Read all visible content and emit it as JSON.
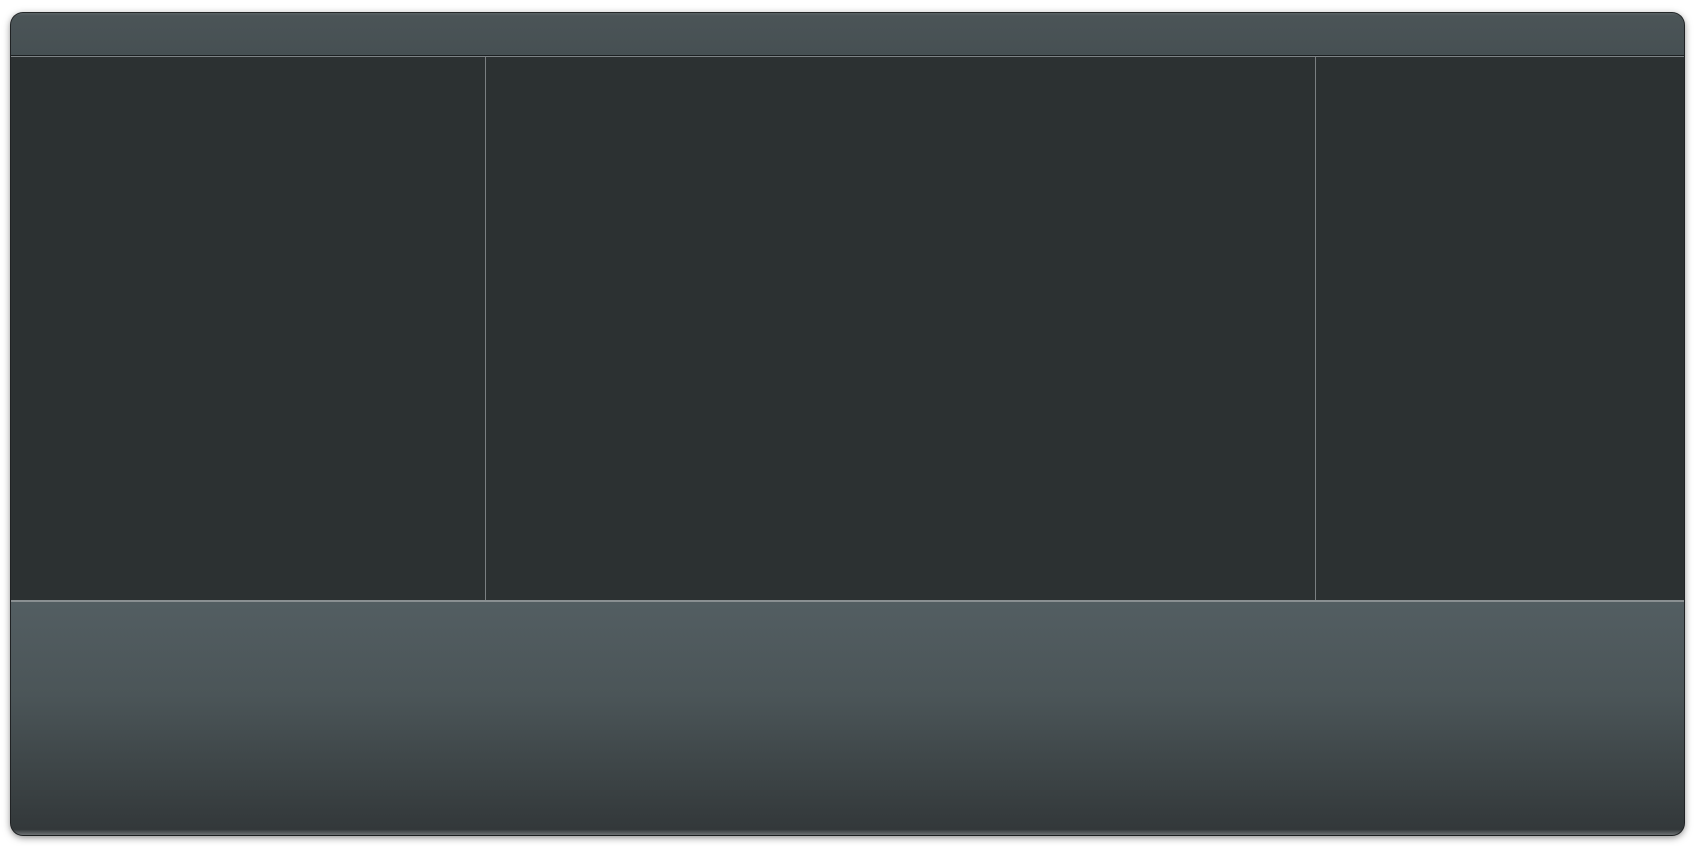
{
  "window": {
    "colors": {
      "titlebar": "#4b5457",
      "pane_background": "#2c3132",
      "bottom_panel": "#4b5558",
      "divider": "#7a7f81"
    }
  }
}
